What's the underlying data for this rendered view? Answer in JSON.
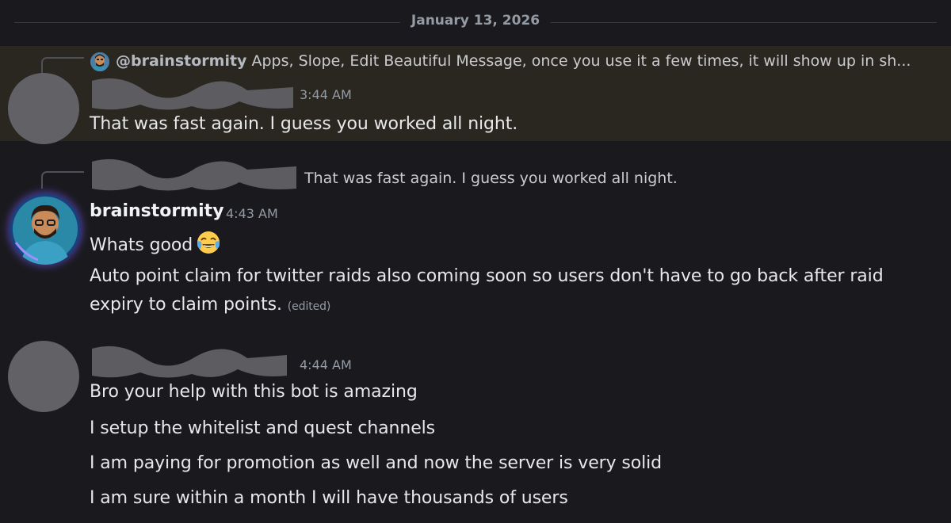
{
  "date_divider": "January 13, 2026",
  "messages": [
    {
      "reply_preview": {
        "mention": "@brainstormity",
        "text": "Apps, Slope, Edit Beautiful Message, once you use it a few times, it will show up in sh..."
      },
      "time": "3:44 AM",
      "lines": [
        "That was fast again. I guess you worked all night."
      ]
    },
    {
      "reply_preview": {
        "text": "That was fast again. I guess you worked all night."
      },
      "username": "brainstormity",
      "time": "4:43 AM",
      "lines": [
        "Whats good",
        "Auto point claim for twitter raids also coming soon so users don't have to go back after raid",
        "expiry to claim points."
      ],
      "edited_label": "(edited)"
    },
    {
      "time": "4:44 AM",
      "lines": [
        "Bro your help with this bot is amazing",
        "I setup the whitelist and quest channels",
        "I am paying for promotion as well and now the server is very solid",
        "I am sure within a month I will have thousands of users"
      ]
    }
  ],
  "colors": {
    "background": "#1a1a1e",
    "highlight": "#2a2620",
    "timestamp": "#949ba4",
    "text": "#e7e8ea"
  }
}
